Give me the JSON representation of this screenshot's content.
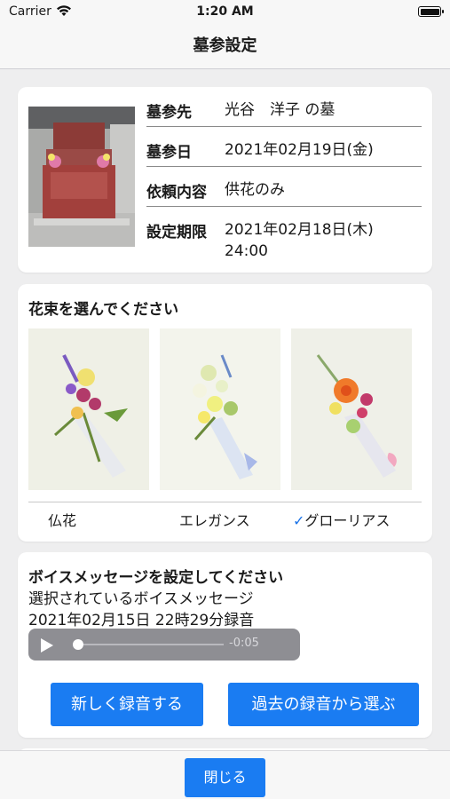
{
  "status": {
    "carrier": "Carrier",
    "time": "1:20 AM"
  },
  "nav": {
    "title": "墓参設定"
  },
  "info": {
    "rows": [
      {
        "label": "墓参先",
        "value": "光谷　洋子 の墓"
      },
      {
        "label": "墓参日",
        "value": "2021年02月19日(金)"
      },
      {
        "label": "依頼内容",
        "value": "供花のみ"
      },
      {
        "label": "設定期限",
        "value": "2021年02月18日(木) 24:00"
      }
    ]
  },
  "flowers": {
    "title": "花束を選んでください",
    "options": [
      {
        "label": "仏花",
        "selected": false
      },
      {
        "label": "エレガンス",
        "selected": false
      },
      {
        "label": "グローリアス",
        "selected": true
      }
    ],
    "check_mark": "✓"
  },
  "voice": {
    "title": "ボイスメッセージを設定してください",
    "selected_label": "選択されているボイスメッセージ",
    "recording": "2021年02月15日 22時29分録音",
    "remaining": "-0:05",
    "progress": 0,
    "new_button": "新しく録音する",
    "past_button": "過去の録音から選ぶ"
  },
  "footer": {
    "close": "閉じる"
  },
  "colors": {
    "accent": "#1a7cf2",
    "background": "#eeeeef"
  }
}
